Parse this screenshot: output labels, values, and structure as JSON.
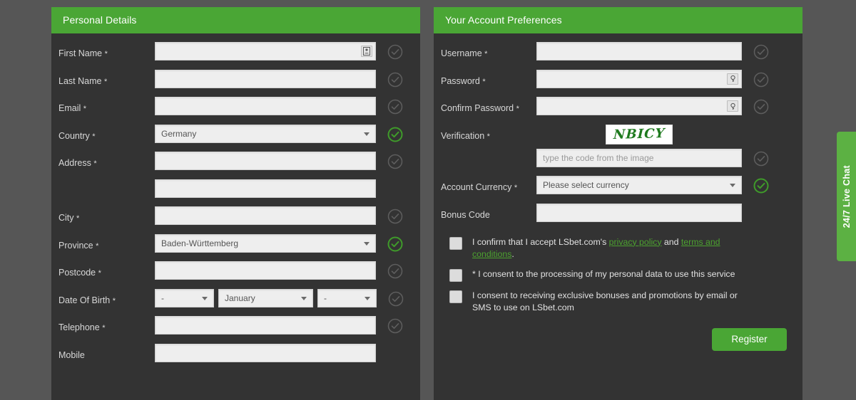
{
  "left_panel": {
    "title": "Personal Details",
    "fields": [
      {
        "label": "First Name",
        "required": true,
        "type": "text",
        "value": "",
        "icon": "id-card-icon",
        "check": "gray"
      },
      {
        "label": "Last Name",
        "required": true,
        "type": "text",
        "value": "",
        "check": "gray"
      },
      {
        "label": "Email",
        "required": true,
        "type": "text",
        "value": "",
        "check": "gray"
      },
      {
        "label": "Country",
        "required": true,
        "type": "select",
        "value": "Germany",
        "check": "green"
      },
      {
        "label": "Address",
        "required": true,
        "type": "text",
        "value": "",
        "check": "gray"
      },
      {
        "label": "",
        "required": false,
        "type": "text",
        "value": "",
        "check": "none"
      },
      {
        "label": "City",
        "required": true,
        "type": "text",
        "value": "",
        "check": "gray"
      },
      {
        "label": "Province",
        "required": true,
        "type": "select",
        "value": "Baden-Württemberg",
        "check": "green"
      },
      {
        "label": "Postcode",
        "required": true,
        "type": "text",
        "value": "",
        "check": "gray"
      },
      {
        "label": "Date Of Birth",
        "required": true,
        "type": "dob",
        "day": "-",
        "month": "January",
        "year": "-",
        "check": "gray"
      },
      {
        "label": "Telephone",
        "required": true,
        "type": "text",
        "value": "",
        "check": "gray"
      },
      {
        "label": "Mobile",
        "required": false,
        "type": "text",
        "value": "",
        "check": "none"
      }
    ]
  },
  "right_panel": {
    "title": "Your Account Preferences",
    "fields": [
      {
        "label": "Username",
        "required": true,
        "type": "text",
        "value": "",
        "check": "gray"
      },
      {
        "label": "Password",
        "required": true,
        "type": "password",
        "value": "",
        "icon": "key-icon",
        "check": "gray"
      },
      {
        "label": "Confirm Password",
        "required": true,
        "type": "password",
        "value": "",
        "icon": "key-icon",
        "check": "gray"
      }
    ],
    "verification": {
      "label": "Verification",
      "required": true,
      "captcha_code": "NBICY",
      "input_placeholder": "type the code from the image",
      "input_value": "",
      "check": "gray"
    },
    "currency": {
      "label": "Account Currency",
      "required": true,
      "value": "Please select currency",
      "check": "green"
    },
    "bonus": {
      "label": "Bonus Code",
      "required": false,
      "value": "",
      "check": "none"
    },
    "consents": [
      {
        "checked": false,
        "pre": "I confirm that I accept LSbet.com's ",
        "link1": "privacy policy",
        "mid": " and ",
        "link2": "terms and conditions",
        "post": "."
      },
      {
        "checked": false,
        "pre": "* I consent to the processing of my personal data to use this service",
        "link1": "",
        "mid": "",
        "link2": "",
        "post": ""
      },
      {
        "checked": false,
        "pre": "I consent to receiving exclusive bonuses and promotions by email or SMS to use on LSbet.com",
        "link1": "",
        "mid": "",
        "link2": "",
        "post": ""
      }
    ],
    "register_label": "Register"
  },
  "live_chat": {
    "label": "24/7 Live Chat"
  },
  "colors": {
    "header_green": "#4aa635",
    "chat_green": "#5cb143",
    "link_green": "#4ca22f",
    "panel_bg": "#333333",
    "page_bg": "#565656",
    "input_bg": "#eeeeee"
  }
}
